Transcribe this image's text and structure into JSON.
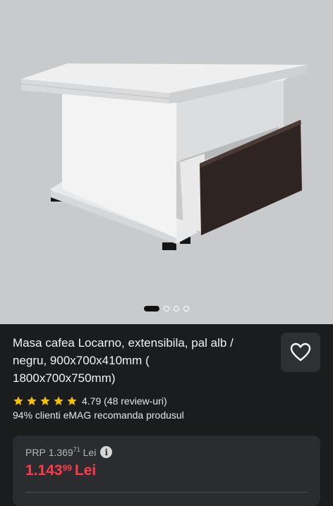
{
  "gallery": {
    "image_alt": "Masa cafea Locarno",
    "image_count": 4,
    "active_index": 0
  },
  "product": {
    "title": "Masa cafea Locarno, extensibila, pal alb / negru, 900x700x410mm ( 1800x700x750mm)",
    "favorite_icon": "heart-icon",
    "rating": "4.79",
    "reviews": "(48 review-uri)",
    "stars": 5,
    "recommend_text": "94% clienti eMAG recomanda produsul"
  },
  "price": {
    "prp_label": "PRP",
    "prp_int": "1.369",
    "prp_dec": "71",
    "prp_currency": "Lei",
    "info_icon": "i",
    "current_int": "1.143",
    "current_dec": "99",
    "current_currency": "Lei"
  },
  "colors": {
    "background": "#1b1c1e",
    "price_red": "#ff3b4a",
    "star_yellow": "#f6c000"
  }
}
